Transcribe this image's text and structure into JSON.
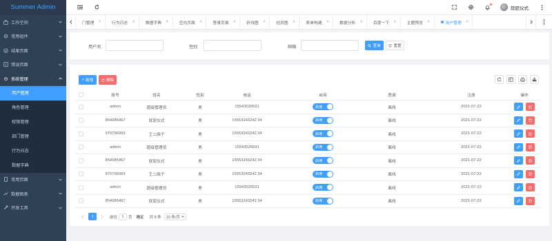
{
  "app": {
    "title": "Summer Admin"
  },
  "sidebar": {
    "items": [
      {
        "label": "工作空间",
        "icon": "briefcase-icon"
      },
      {
        "label": "常用组件",
        "icon": "gear-icon"
      },
      {
        "label": "结果页面",
        "icon": "check-circle-icon"
      },
      {
        "label": "错误页面",
        "icon": "warning-icon"
      },
      {
        "label": "系统管理",
        "icon": "settings-icon"
      }
    ],
    "submenu": [
      "用户管理",
      "角色管理",
      "权限管理",
      "部门管理",
      "行为日志",
      "数据字典"
    ],
    "bottom_items": [
      {
        "label": "常用页面",
        "icon": "page-icon"
      },
      {
        "label": "数据图表",
        "icon": "chart-icon"
      },
      {
        "label": "开发工具",
        "icon": "wrench-icon"
      }
    ]
  },
  "topbar": {
    "user_name": "就屁仪式"
  },
  "tabs": [
    "门管理",
    "行为日志",
    "数据字典",
    "空白页面",
    "登录页面",
    "折线图",
    "柱状图",
    "表单构建",
    "数据分析",
    "百度一下",
    "主题预览",
    "用户管理"
  ],
  "active_tab": "用户管理",
  "search": {
    "username_label": "用户名",
    "gender_label": "性别",
    "email_label": "邮箱",
    "search_button": "查询",
    "reset_button": "重置"
  },
  "toolbar": {
    "add_button": "新增",
    "delete_button": "删除"
  },
  "table": {
    "columns": [
      "账号",
      "姓名",
      "性别",
      "电话",
      "启用",
      "登录",
      "注册",
      "操作"
    ],
    "switch_label": "启用",
    "rows": [
      {
        "account": "admin",
        "name": "超级管理员",
        "gender": "男",
        "phone": "15543526531",
        "login": "离线",
        "register": "2021-07-22"
      },
      {
        "account": "854085467",
        "name": "就屁仪式",
        "gender": "男",
        "phone": "15553243242 34",
        "login": "离线",
        "register": "2021-07-22"
      },
      {
        "account": "970796069",
        "name": "王二麻子",
        "gender": "男",
        "phone": "15553243242 34",
        "login": "离线",
        "register": "2021-07-22"
      },
      {
        "account": "admin",
        "name": "超级管理员",
        "gender": "男",
        "phone": "15543526531",
        "login": "离线",
        "register": "2021-07-22"
      },
      {
        "account": "854085467",
        "name": "就屁仪式",
        "gender": "男",
        "phone": "15553243242 34",
        "login": "离线",
        "register": "2021-07-22"
      },
      {
        "account": "970796069",
        "name": "王二麻子",
        "gender": "男",
        "phone": "15553243242 34",
        "login": "离线",
        "register": "2021-07-22"
      },
      {
        "account": "admin",
        "name": "超级管理员",
        "gender": "男",
        "phone": "15543526531",
        "login": "离线",
        "register": "2021-07-22"
      },
      {
        "account": "854085467",
        "name": "就屁仪式",
        "gender": "男",
        "phone": "15553243242 34",
        "login": "离线",
        "register": "2021-07-22"
      }
    ]
  },
  "pagination": {
    "current": "1",
    "goto_label": "前往",
    "goto_value": "1",
    "page_label": "页",
    "confirm_label": "确定",
    "total": "共 8 条",
    "page_size": "10 条/页"
  },
  "colors": {
    "primary": "#409eff",
    "danger": "#f56c6c",
    "sidebar": "#304156",
    "sidebar_sub": "#1f2d3d"
  }
}
